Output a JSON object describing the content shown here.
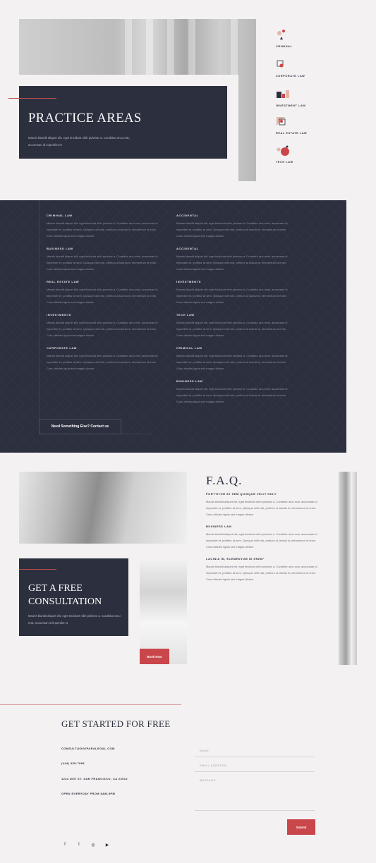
{
  "hero": {
    "title": "PRACTICE AREAS",
    "text": "Mauris blandit aliquet elit, eget tincidunt nibh pulvinar a. Curabitur arcu erat, accumsan id imperdiet et"
  },
  "practice_icons": [
    {
      "label": "CRIMINAL",
      "icon": "criminal-icon"
    },
    {
      "label": "CORPORATE LAW",
      "icon": "corporate-law-icon"
    },
    {
      "label": "INVESTMENT LAW",
      "icon": "investment-law-icon"
    },
    {
      "label": "REAL ESTATE LAW",
      "icon": "real-estate-law-icon"
    },
    {
      "label": "TECH LAW",
      "icon": "tech-law-icon"
    }
  ],
  "practice_areas": {
    "left": [
      {
        "title": "CRIMINAL LAW",
        "body": "Mauris blandit aliquet elit, eget tincidunt nibh pulvinar a. Curabitur arcu erat, accumsan id imperdiet et, porttitor at sem. Quisque velit nisi, pretium ut lacinia in, elementum id enim. Cras ultricies ligula sed magna dictum"
      },
      {
        "title": "BUSINESS LAW",
        "body": "Mauris blandit aliquet elit, eget tincidunt nibh pulvinar a. Curabitur arcu erat, accumsan id imperdiet et, porttitor at sem. Quisque velit nisi, pretium ut lacinia in, elementum id enim. Cras ultricies ligula sed magna dictum"
      },
      {
        "title": "REAL ESTATE LAW",
        "body": "Mauris blandit aliquet elit, eget tincidunt nibh pulvinar a. Curabitur arcu erat, accumsan id imperdiet et, porttitor at sem. Quisque velit nisi, pretium ut lacinia in, elementum id enim. Cras ultricies ligula sed magna dictum"
      },
      {
        "title": "INVESTMENTS",
        "body": "Mauris blandit aliquet elit, eget tincidunt nibh pulvinar a. Curabitur arcu erat, accumsan id imperdiet et, porttitor at sem. Quisque velit nisi, pretium ut lacinia in, elementum id enim. Cras ultricies ligula sed magna dictum"
      },
      {
        "title": "CORPORATE LAW",
        "body": "Mauris blandit aliquet elit, eget tincidunt nibh pulvinar a. Curabitur arcu erat, accumsan id imperdiet et, porttitor at sem. Quisque velit nisi, pretium ut lacinia in, elementum id enim. Cras ultricies ligula sed magna dictum"
      }
    ],
    "right": [
      {
        "title": "ACCIDENTAL",
        "body": "Mauris blandit aliquet elit, eget tincidunt nibh pulvinar a. Curabitur arcu erat, accumsan id imperdiet et, porttitor at sem. Quisque velit nisi, pretium ut lacinia in, elementum id enim. Cras ultricies ligula sed magna dictum"
      },
      {
        "title": "ACCIDENTAL",
        "body": "Mauris blandit aliquet elit, eget tincidunt nibh pulvinar a. Curabitur arcu erat, accumsan id imperdiet et, porttitor at sem. Quisque velit nisi, pretium ut lacinia in, elementum id enim. Cras ultricies ligula sed magna dictum"
      },
      {
        "title": "INVESTMENTS",
        "body": "Mauris blandit aliquet elit, eget tincidunt nibh pulvinar a. Curabitur arcu erat, accumsan id imperdiet et, porttitor at sem. Quisque velit nisi, pretium ut lacinia in, elementum id enim. Cras ultricies ligula sed magna dictum"
      },
      {
        "title": "TECH LAW",
        "body": "Mauris blandit aliquet elit, eget tincidunt nibh pulvinar a. Curabitur arcu erat, accumsan id imperdiet et, porttitor at sem. Quisque velit nisi, pretium ut lacinia in, elementum id enim. Cras ultricies ligula sed magna dictum"
      },
      {
        "title": "CRIMINAL LAW",
        "body": "Mauris blandit aliquet elit, eget tincidunt nibh pulvinar a. Curabitur arcu erat, accumsan id imperdiet et, porttitor at sem. Quisque velit nisi, pretium ut lacinia in, elementum id enim. Cras ultricies ligula sed magna dictum"
      },
      {
        "title": "BUSINESS LAW",
        "body": "Mauris blandit aliquet elit, eget tincidunt nibh pulvinar a. Curabitur arcu erat, accumsan id imperdiet et, porttitor at sem. Quisque velit nisi, pretium ut lacinia in, elementum id enim. Cras ultricies ligula sed magna dictum"
      }
    ],
    "contact_button": "Need Something Else? Contact us"
  },
  "consultation": {
    "title": "GET A FREE CONSULTATION",
    "text": "Mauris blandit aliquet elit, eget tincidunt nibh pulvinar a. Curabitur arcu erat, accumsan id imperdiet et",
    "book_button": "Book Now"
  },
  "faq": {
    "title": "F.A.Q.",
    "items": [
      {
        "q": "PORTTITOR AT SEM QUISQUE VELIT NISI?",
        "a": "Mauris blandit aliquet elit, eget tincidunt nibh pulvinar a. Curabitur arcu erat, accumsan id imperdiet et, porttitor at sem. Quisque velit nisi, pretium ut lacinia in, elementum id enim. Cras ultricies ligula sed magna dictum"
      },
      {
        "q": "BUSINESS LAW",
        "a": "Mauris blandit aliquet elit, eget tincidunt nibh pulvinar a. Curabitur arcu erat, accumsan id imperdiet et, porttitor at sem. Quisque velit nisi, pretium ut lacinia in, elementum id enim. Cras ultricies ligula sed magna dictum"
      },
      {
        "q": "LACINIA IN, ELEMENTUM ID ENIM?",
        "a": "Mauris blandit aliquet elit, eget tincidunt nibh pulvinar a. Curabitur arcu erat, accumsan id imperdiet et, porttitor at sem. Quisque velit nisi, pretium ut lacinia in, elementum id enim. Cras ultricies ligula sed magna dictum"
      }
    ]
  },
  "get_started": {
    "title": "GET STARTED FOR  FREE",
    "email": "CONSULT@DIVIPARALEGAL.COM",
    "phone": "(444) 355-7896",
    "address": "1234 DIVI ST. SAN FRANCISCO, CA 23512",
    "hours": "OPEN EVERYDAY FROM 8AM-5PM",
    "form": {
      "name": "NAME",
      "email": "EMAIL ADDRESS",
      "message": "MESSAGE",
      "submit": "Submit"
    },
    "social": [
      {
        "icon": "facebook-icon",
        "glyph": "f"
      },
      {
        "icon": "twitter-icon",
        "glyph": "t"
      },
      {
        "icon": "instagram-icon",
        "glyph": "◎"
      },
      {
        "icon": "youtube-icon",
        "glyph": "▶"
      }
    ]
  },
  "colors": {
    "dark": "#2c2f3e",
    "accent": "#c9464a",
    "background": "#f3f1f1"
  }
}
